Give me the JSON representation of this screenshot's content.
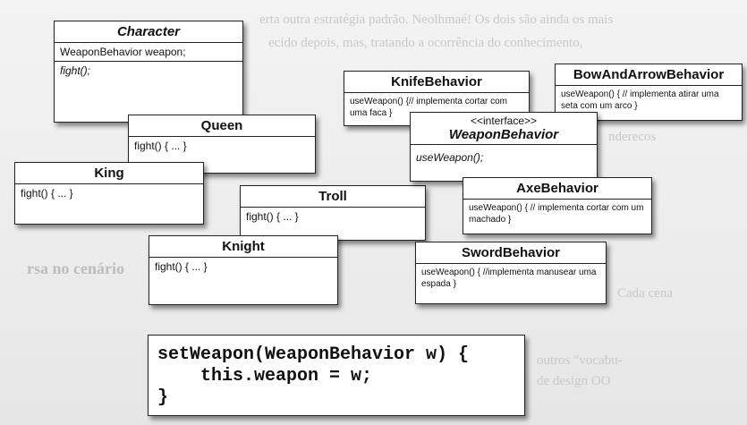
{
  "boxes": {
    "character": {
      "name": "Character",
      "field": "WeaponBehavior weapon;",
      "method": "fight();"
    },
    "queen": {
      "name": "Queen",
      "method": "fight() { ... }"
    },
    "king": {
      "name": "King",
      "method": "fight() { ... }"
    },
    "troll": {
      "name": "Troll",
      "method": "fight() { ... }"
    },
    "knight": {
      "name": "Knight",
      "method": "fight() { ... }"
    },
    "knife": {
      "name": "KnifeBehavior",
      "method": "useWeapon() {// implementa cortar com uma faca }"
    },
    "bow": {
      "name": "BowAndArrowBehavior",
      "method": "useWeapon() { // implementa atirar uma seta com um arco }"
    },
    "weapon": {
      "stereotype": "<<interface>>",
      "name": "WeaponBehavior",
      "method": "useWeapon();"
    },
    "axe": {
      "name": "AxeBehavior",
      "method": "useWeapon() { // implementa cortar com um machado }"
    },
    "sword": {
      "name": "SwordBehavior",
      "method": "useWeapon() { //implementa manusear uma espada }"
    }
  },
  "code": {
    "line1": "setWeapon(WeaponBehavior w) {",
    "line2": "    this.weapon = w;",
    "line3": "}"
  }
}
